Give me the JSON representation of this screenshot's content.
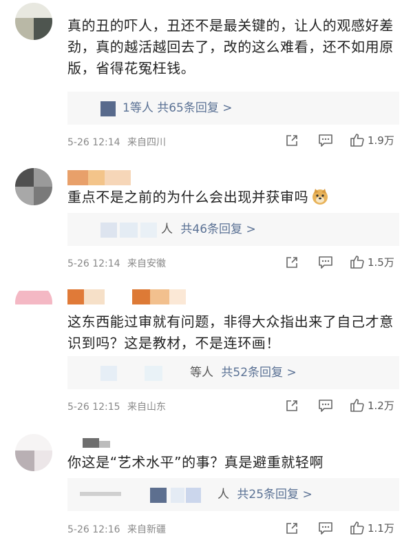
{
  "comments": [
    {
      "text": "真的丑的吓人，丑还不是最关键的，让人的观感好差劲，真的越活越回去了，改的这么难看，还不如用原版，省得花冤枉钱。",
      "reply_prefix": "1等人",
      "reply_total": "共65条回复 >",
      "date": "5-26 12:14",
      "location": "来自四川",
      "likes": "1.9万"
    },
    {
      "text": "重点不是之前的为什么会出现并获审吗",
      "emoji": "doge",
      "reply_prefix": "人",
      "reply_total": "共46条回复 >",
      "date": "5-26 12:14",
      "location": "来自安徽",
      "likes": "1.5万"
    },
    {
      "text": "这东西能过审就有问题，非得大众指出来了自己才意识到吗？这是教材，不是连环画！",
      "reply_prefix": "等人",
      "reply_total": "共52条回复 >",
      "date": "5-26 12:15",
      "location": "来自山东",
      "likes": "1.2万"
    },
    {
      "text": "你这是“艺术水平”的事？真是避重就轻啊",
      "reply_prefix": "人",
      "reply_total": "共25条回复 >",
      "date": "5-26 12:16",
      "location": "来自新疆",
      "likes": "1.1万"
    }
  ],
  "icons": {
    "share": "share-icon",
    "comment": "comment-icon",
    "like": "thumbs-up-icon"
  },
  "colors": {
    "reply_link": "#5a7194",
    "meta_text": "#888888",
    "reply_bg": "#f7f7f7"
  }
}
